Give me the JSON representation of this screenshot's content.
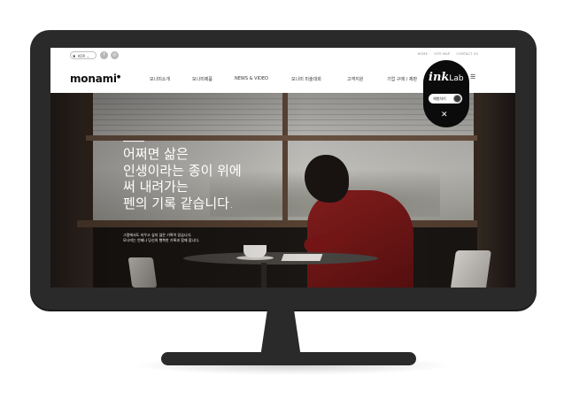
{
  "utility_bar": {
    "language": "KOR",
    "sns": [
      {
        "icon": "facebook-icon",
        "glyph": "f"
      },
      {
        "icon": "instagram-icon",
        "glyph": "◎"
      }
    ],
    "links": [
      "HOME",
      "SITE MAP",
      "CONTACT US"
    ]
  },
  "nav": {
    "logo": "monami",
    "menu": [
      "모나미소개",
      "모나미제품",
      "NEWS & VIDEO",
      "모나미 미술대회",
      "고객지원",
      "기업 구매 / 제판"
    ],
    "icons": [
      "search-icon",
      "menu-icon"
    ]
  },
  "hero": {
    "title_lines": [
      "어쩌면 삶은",
      "인생이라는 종이 위에",
      "써 내려가는",
      "펜의 기록 같습니다."
    ],
    "subtitle_lines": [
      "그럼에서도 지우고 싶지 않은 기록이 있습니다.",
      "모나미는 언제나 당신의 행복한 기록과 함께 합니다."
    ]
  },
  "inklab": {
    "brand_ink": "ink",
    "brand_lab": "Lab",
    "button_label": "체험하기",
    "close_glyph": "✕"
  },
  "colors": {
    "monitor_bezel": "#2a2a2a",
    "inklab_bg": "#0b0b0b",
    "sweater_red": "#8a1e1e"
  }
}
